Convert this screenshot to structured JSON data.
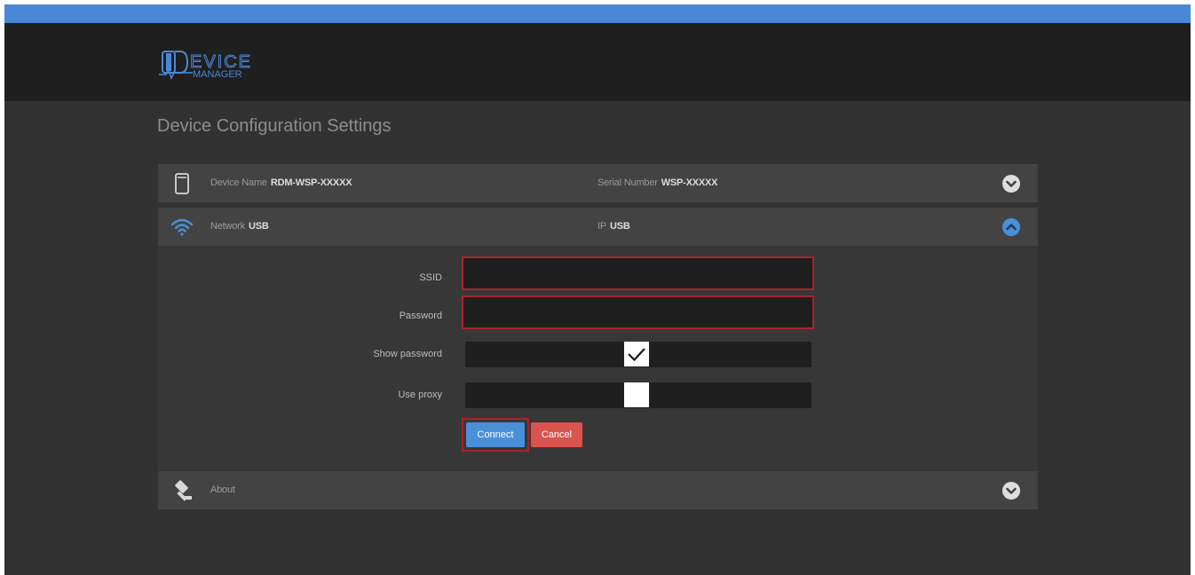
{
  "app": {
    "logo_text_1": "EVICE",
    "logo_text_2": "MANAGER",
    "page_title": "Device Configuration Settings"
  },
  "colors": {
    "accent": "#4a90d9",
    "error_border": "#a8232a",
    "cancel": "#d9534f",
    "header_bg": "#1f1f1f",
    "body_bg": "#323232"
  },
  "rows": {
    "device": {
      "icon": "device-icon",
      "name_label": "Device Name",
      "name_value": "RDM-WSP-XXXXX",
      "serial_label": "Serial Number",
      "serial_value": "WSP-XXXXX",
      "toggle_icon": "chevron-down-icon"
    },
    "network": {
      "icon": "wifi-icon",
      "network_label": "Network",
      "network_value": "USB",
      "ip_label": "IP",
      "ip_value": "USB",
      "toggle_icon": "chevron-up-icon"
    },
    "about": {
      "icon": "gavel-icon",
      "label": "About",
      "toggle_icon": "chevron-down-icon"
    }
  },
  "form": {
    "ssid_label": "SSID",
    "ssid_value": "",
    "password_label": "Password",
    "password_value": "",
    "show_password_label": "Show password",
    "show_password_checked": true,
    "use_proxy_label": "Use proxy",
    "use_proxy_checked": false,
    "connect_label": "Connect",
    "cancel_label": "Cancel"
  }
}
